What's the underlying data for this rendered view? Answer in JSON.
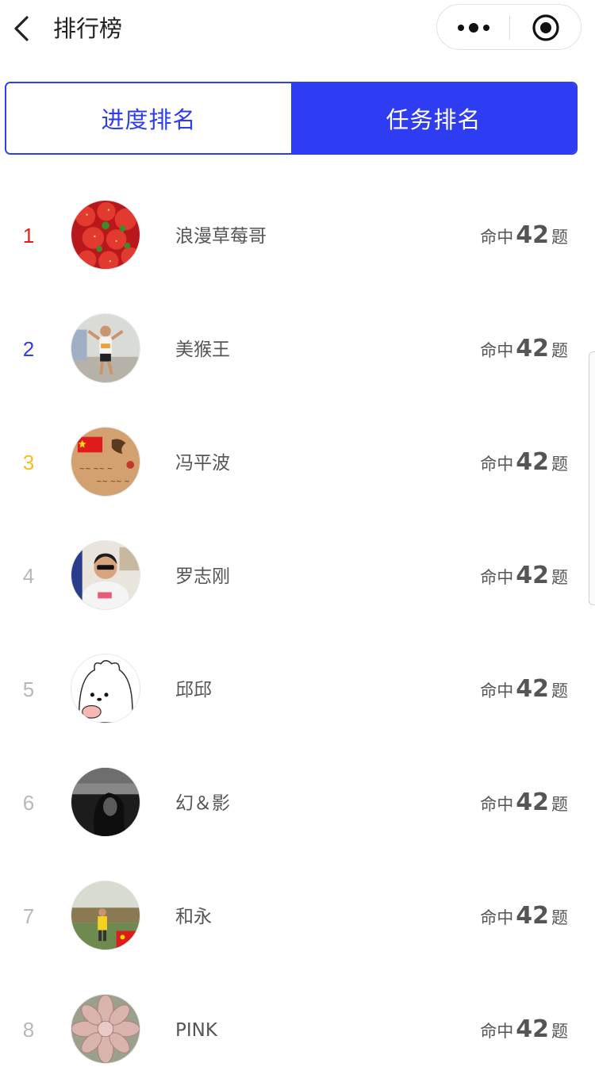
{
  "navbar": {
    "title": "排行榜",
    "back_icon": "chevron-left-icon",
    "more_icon": "more-dots-icon",
    "close_icon": "target-icon"
  },
  "tabs": [
    {
      "label": "进度排名",
      "active": false
    },
    {
      "label": "任务排名",
      "active": true
    }
  ],
  "colors": {
    "accent": "#2e3cf2",
    "rank1": "#e02020",
    "rank2": "#2e3cf2",
    "rank3": "#f0c020",
    "rank_other": "#b8b8b8"
  },
  "leaderboard": [
    {
      "rank": "1",
      "name": "浪漫草莓哥",
      "prefix": "命中",
      "count": "42",
      "suffix": "题"
    },
    {
      "rank": "2",
      "name": "美猴王",
      "prefix": "命中",
      "count": "42",
      "suffix": "题"
    },
    {
      "rank": "3",
      "name": "冯平波",
      "prefix": "命中",
      "count": "42",
      "suffix": "题"
    },
    {
      "rank": "4",
      "name": "罗志刚",
      "prefix": "命中",
      "count": "42",
      "suffix": "题"
    },
    {
      "rank": "5",
      "name": "邱邱",
      "prefix": "命中",
      "count": "42",
      "suffix": "题"
    },
    {
      "rank": "6",
      "name": "幻＆影",
      "prefix": "命中",
      "count": "42",
      "suffix": "题"
    },
    {
      "rank": "7",
      "name": "和永",
      "prefix": "命中",
      "count": "42",
      "suffix": "题"
    },
    {
      "rank": "8",
      "name": "PINK",
      "prefix": "命中",
      "count": "42",
      "suffix": "题"
    }
  ]
}
